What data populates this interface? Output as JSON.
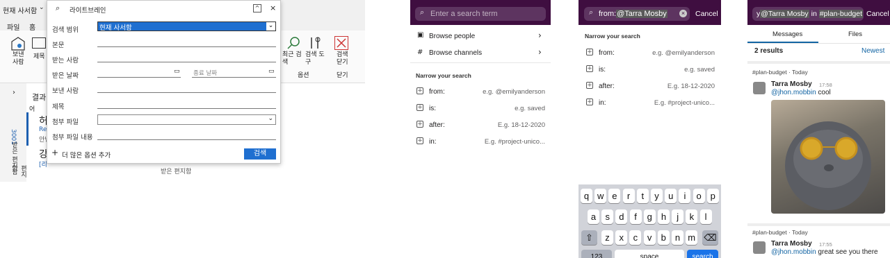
{
  "outlook": {
    "scope": "현재 사서함",
    "search_query": "라이트브레인",
    "menu": [
      "파일",
      "홈"
    ],
    "ribbon": {
      "send_label": "보낸\n사람",
      "subject_label": "제목",
      "recent_label": "최근 검\n색",
      "tools_label": "검색 도\n구",
      "close_label": "검색\n닫기",
      "options_group": "옵션",
      "close_group": "닫기"
    },
    "results_label": "결과",
    "group_label": "어",
    "vertical_tabs": [
      "받은 편지함",
      "3001",
      "보낸 편지함"
    ],
    "items": [
      {
        "sender": "허",
        "preview1": "Res",
        "preview2": "안녕"
      },
      {
        "sender": "강",
        "preview1": "[리"
      }
    ],
    "folder_label": "받은 편지함",
    "dialog": {
      "fields": [
        "검색 범위",
        "본문",
        "받는 사람",
        "받은 날짜",
        "보낸 사람",
        "제목",
        "첨부 파일",
        "첨부 파일 내용"
      ],
      "scope_value": "현재 사서함",
      "end_date_placeholder": "종료 날짜",
      "add_more": "더 많은 옵션 추가",
      "search_button": "검색"
    }
  },
  "slack1": {
    "placeholder": "Enter a search term",
    "browse_people": "Browse people",
    "browse_channels": "Browse channels",
    "narrow": "Narrow your search",
    "filters": [
      {
        "label": "from:",
        "hint": "e.g. @emilyanderson"
      },
      {
        "label": "is:",
        "hint": "e.g. saved"
      },
      {
        "label": "after:",
        "hint": "E.g. 18-12-2020"
      },
      {
        "label": "in:",
        "hint": "E.g. #project-unico..."
      }
    ]
  },
  "slack2": {
    "query_prefix": "from:",
    "query_token": "@Tarra Mosby",
    "cancel": "Cancel",
    "narrow": "Narrow your search",
    "filters": [
      {
        "label": "from:",
        "hint": "e.g. @emilyanderson"
      },
      {
        "label": "is:",
        "hint": "e.g. saved"
      },
      {
        "label": "after:",
        "hint": "E.g. 18-12-2020"
      },
      {
        "label": "in:",
        "hint": "E.g. #project-unico..."
      }
    ],
    "keys_row1": [
      "q",
      "w",
      "e",
      "r",
      "t",
      "y",
      "u",
      "i",
      "o",
      "p"
    ],
    "keys_row2": [
      "a",
      "s",
      "d",
      "f",
      "g",
      "h",
      "j",
      "k",
      "l"
    ],
    "keys_row3": [
      "z",
      "x",
      "c",
      "v",
      "b",
      "n",
      "m"
    ],
    "key_123": "123",
    "key_space": "space",
    "key_search": "search"
  },
  "slack3": {
    "q_a": "y",
    "q_token1": "@Tarra Mosby",
    "q_in": "in",
    "q_token2": "#plan-budget",
    "cancel": "Cancel",
    "tab_messages": "Messages",
    "tab_files": "Files",
    "results": "2 results",
    "sort": "Newest",
    "channel": "#plan-budget",
    "day": "Today",
    "messages": [
      {
        "author": "Tarra Mosby",
        "time": "17:58",
        "mention": "@jhon.mobbin",
        "text": "cool"
      },
      {
        "author": "Tarra Mosby",
        "time": "17:55",
        "mention": "@jhon.mobbin",
        "text": "great see you there"
      }
    ]
  }
}
